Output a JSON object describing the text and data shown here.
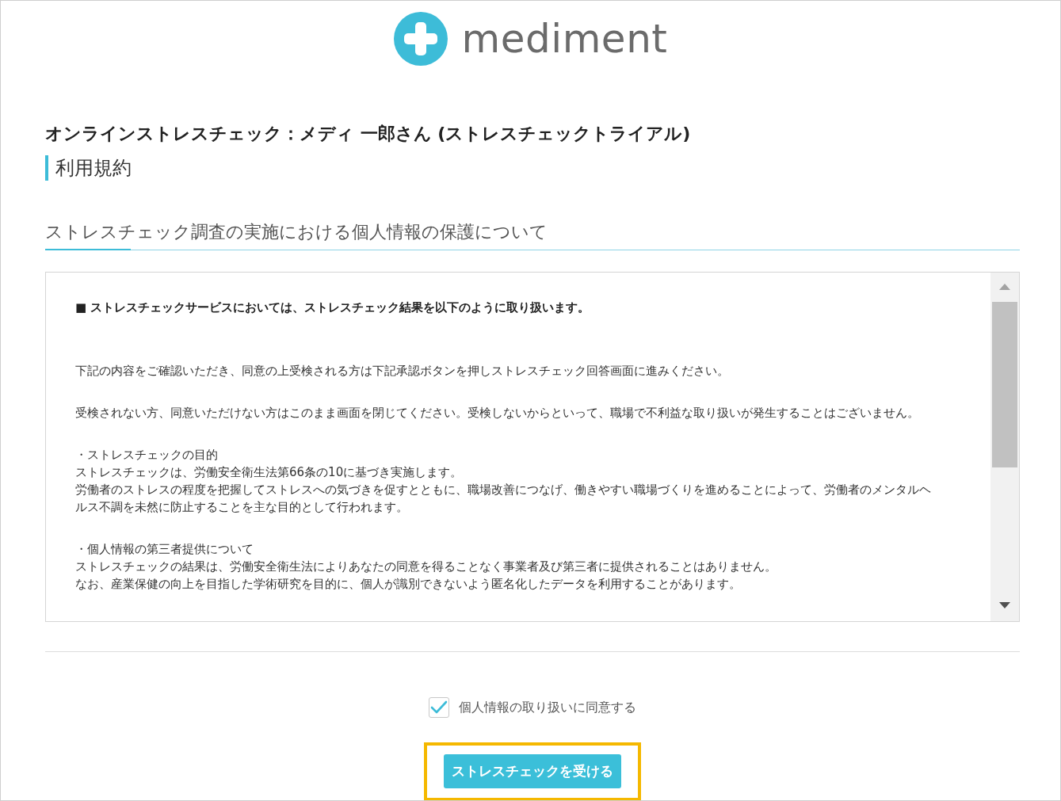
{
  "header": {
    "logo_text": "mediment"
  },
  "page": {
    "title": "オンラインストレスチェック：メディ 一郎さん (ストレスチェックトライアル)",
    "subtitle": "利用規約"
  },
  "section": {
    "heading": "ストレスチェック調査の実施における個人情報の保護について"
  },
  "terms": {
    "intro": "■ ストレスチェックサービスにおいては、ストレスチェック結果を以下のように取り扱います。",
    "blocks": [
      {
        "lines": [
          "下記の内容をご確認いただき、同意の上受検される方は下記承認ボタンを押しストレスチェック回答画面に進みください。"
        ]
      },
      {
        "lines": [
          "受検されない方、同意いただけない方はこのまま画面を閉じてください。受検しないからといって、職場で不利益な取り扱いが発生することはございません。"
        ]
      },
      {
        "lines": [
          "・ストレスチェックの目的",
          "ストレスチェックは、労働安全衛生法第66条の10に基づき実施します。",
          "労働者のストレスの程度を把握してストレスへの気づきを促すとともに、職場改善につなげ、働きやすい職場づくりを進めることによって、労働者のメンタルヘルス不調を未然に防止することを主な目的として行われます。"
        ]
      },
      {
        "lines": [
          "・個人情報の第三者提供について",
          "ストレスチェックの結果は、労働安全衛生法によりあなたの同意を得ることなく事業者及び第三者に提供されることはありません。",
          "なお、産業保健の向上を目指した学術研究を目的に、個人が識別できないよう匿名化したデータを利用することがあります。"
        ]
      }
    ]
  },
  "agreement": {
    "label": "個人情報の取り扱いに同意する",
    "checked": true
  },
  "submit_button": {
    "label": "ストレスチェックを受ける",
    "highlighted": true
  }
}
